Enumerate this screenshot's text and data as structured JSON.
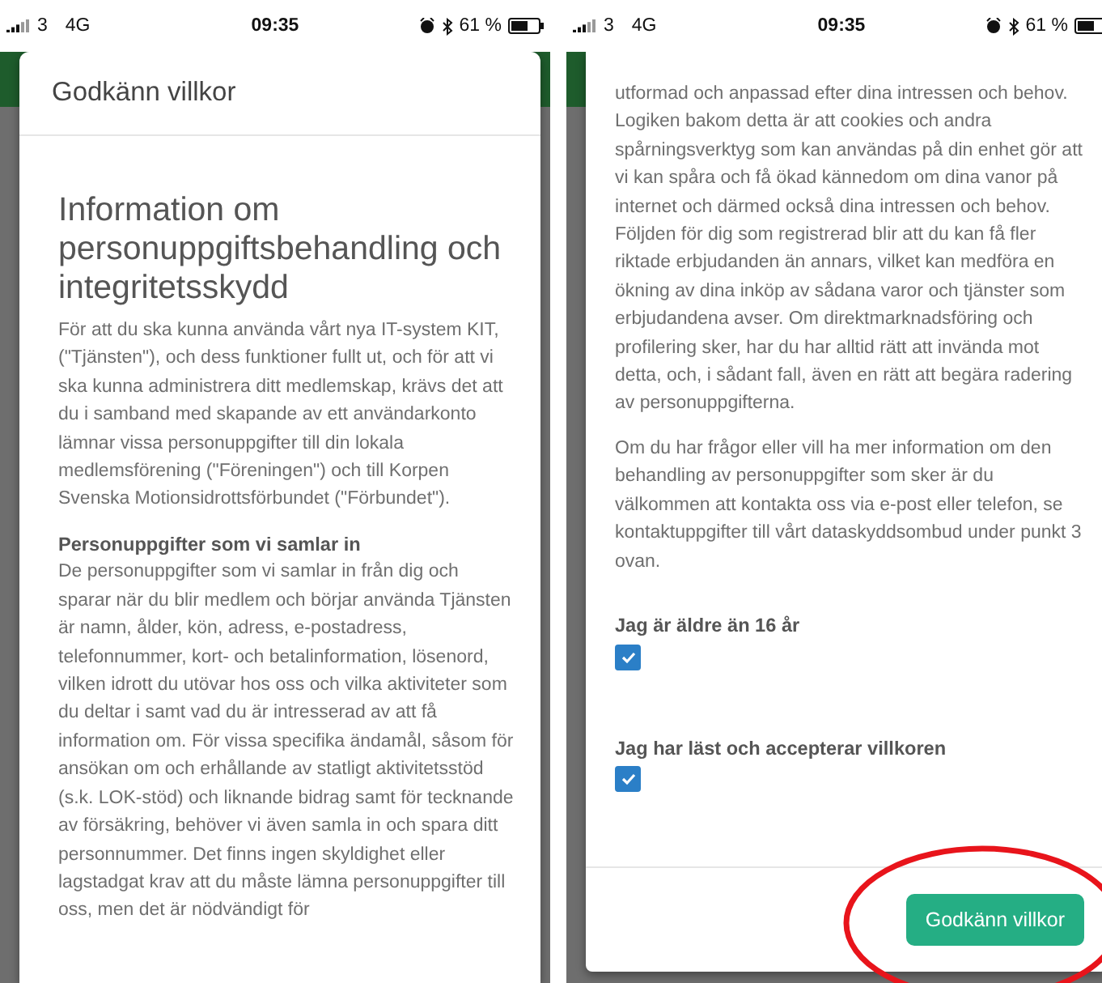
{
  "phones": [
    {
      "status": {
        "carrier": "3",
        "network": "4G",
        "time": "09:35",
        "battery": "61 %"
      },
      "dialog": {
        "title": "Godkänn villkor",
        "blocks": [
          {
            "kind": "heading",
            "text": "Information om personuppgiftsbehandling och integritetsskydd"
          },
          {
            "kind": "text",
            "text": "För att du ska kunna använda vårt nya IT-system KIT, (\"Tjänsten\"), och dess funktioner fullt ut, och för att vi ska kunna administrera ditt medlemskap, krävs det att du i samband med skapande av ett användarkonto lämnar vissa personuppgifter till din lokala medlemsförening (\"Föreningen\") och till Korpen Svenska Motionsidrottsförbundet (\"Förbundet\")."
          },
          {
            "kind": "subheading",
            "text": "Personuppgifter som vi samlar in"
          },
          {
            "kind": "body",
            "text": "De personuppgifter som vi samlar in från dig och sparar när du blir medlem och börjar använda Tjänsten är namn, ålder, kön, adress, e-postadress, telefonnummer, kort- och betalinformation, lösenord, vilken idrott du utövar hos oss och vilka aktiviteter som du deltar i samt vad du är intresserad av att få information om. För vissa specifika ändamål, såsom för ansökan om och erhållande av statligt aktivitetsstöd (s.k. LOK-stöd) och liknande bidrag samt för tecknande av försäkring, behöver vi även samla in och spara ditt personnummer. Det finns ingen skyldighet eller lagstadgat krav att du måste lämna personuppgifter till oss, men det är nödvändigt för"
          }
        ]
      }
    },
    {
      "status": {
        "carrier": "3",
        "network": "4G",
        "time": "09:35",
        "battery": "61 %"
      },
      "dialog": {
        "blocks": [
          {
            "kind": "body",
            "text": "utformad och anpassad efter dina intressen och behov. Logiken bakom detta är att cookies och andra spårningsverktyg som kan användas på din enhet gör att vi kan spåra och få ökad kännedom om dina vanor på internet och därmed också dina intressen och behov. Följden för dig som registrerad blir att du kan få fler riktade erbjudanden än annars, vilket kan medföra en ökning av dina inköp av sådana varor och tjänster som erbjudandena avser. Om direktmarknadsföring och profilering sker, har du har alltid rätt att invända mot detta, och, i sådant fall, även en rätt att begära radering av personuppgifterna."
          },
          {
            "kind": "text",
            "text": "Om du har frågor eller vill ha mer information om den behandling av personuppgifter som sker är du välkommen att kontakta oss via e-post eller telefon, se kontaktuppgifter till vårt dataskyddsombud under punkt 3 ovan."
          },
          {
            "kind": "checkbox",
            "text": "Jag är äldre än 16 år",
            "checked": true
          },
          {
            "kind": "checkbox",
            "text": "Jag har läst och accepterar villkoren",
            "checked": true
          }
        ],
        "button": "Godkänn villkor"
      }
    }
  ]
}
